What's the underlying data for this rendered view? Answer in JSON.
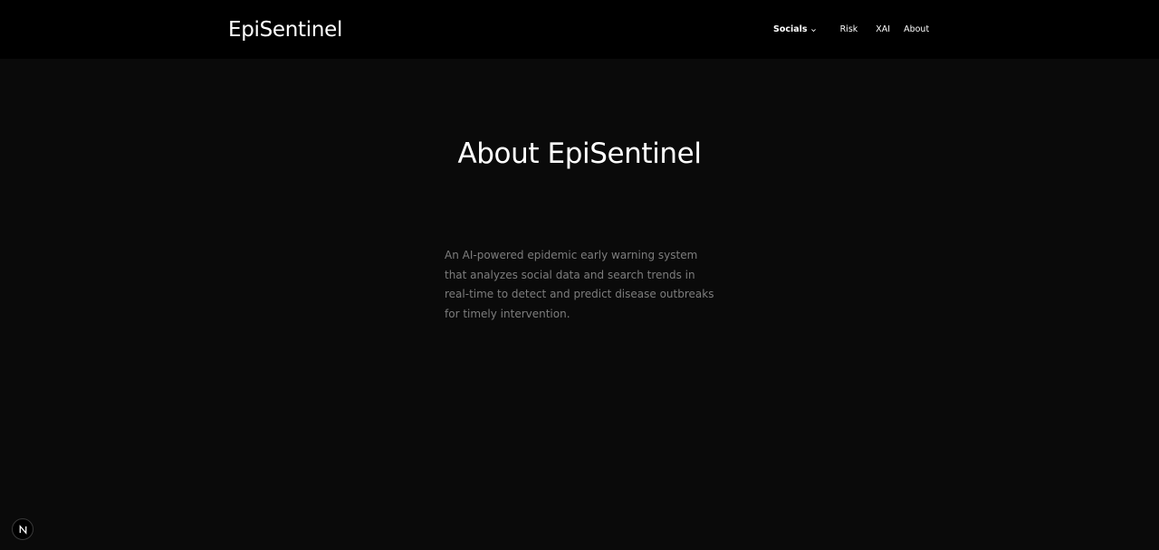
{
  "header": {
    "brand": "EpiSentinel",
    "nav": {
      "socials": "Socials",
      "risk": "Risk",
      "xai": "XAI",
      "about": "About"
    }
  },
  "main": {
    "title": "About EpiSentinel",
    "description": "An AI-powered epidemic early warning system that analyzes social data and search trends in real-time to detect and predict disease outbreaks for timely intervention."
  },
  "dev_badge": {
    "icon": "nextjs-logo-icon"
  },
  "colors": {
    "background": "#0a0a0a",
    "header_background": "#000000",
    "text_primary": "#ffffff",
    "text_muted": "#7d7d7d"
  }
}
